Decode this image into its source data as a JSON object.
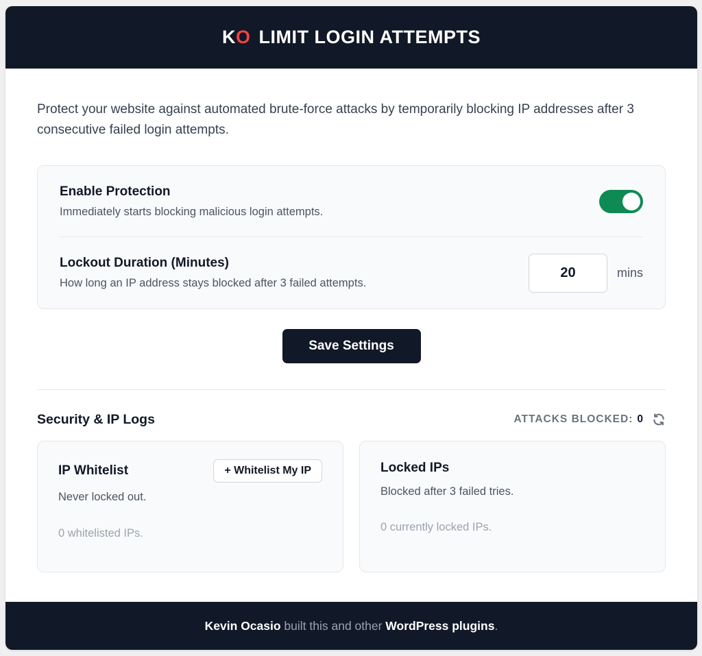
{
  "header": {
    "logo_k": "K",
    "logo_o": "O",
    "title": "LIMIT LOGIN ATTEMPTS"
  },
  "intro": "Protect your website against automated brute-force attacks by temporarily blocking IP addresses after 3 consecutive failed login attempts.",
  "settings": {
    "protection": {
      "title": "Enable Protection",
      "description": "Immediately starts blocking malicious login attempts.",
      "enabled": true
    },
    "lockout": {
      "title": "Lockout Duration (Minutes)",
      "description": "How long an IP address stays blocked after 3 failed attempts.",
      "value": "20",
      "unit": "mins"
    }
  },
  "save_label": "Save Settings",
  "logs": {
    "title": "Security & IP Logs",
    "attacks_label": "ATTACKS BLOCKED:",
    "attacks_count": "0",
    "whitelist": {
      "title": "IP Whitelist",
      "button_label": "+ Whitelist My IP",
      "description": "Never locked out.",
      "empty_text": "0 whitelisted IPs."
    },
    "locked": {
      "title": "Locked IPs",
      "description": "Blocked after 3 failed tries.",
      "empty_text": "0 currently locked IPs."
    }
  },
  "footer": {
    "author": "Kevin Ocasio",
    "middle": " built this and other ",
    "link": "WordPress plugins",
    "end": "."
  },
  "colors": {
    "header_bg": "#111827",
    "logo_o": "#ef4444",
    "toggle_on": "#0e8a55"
  }
}
